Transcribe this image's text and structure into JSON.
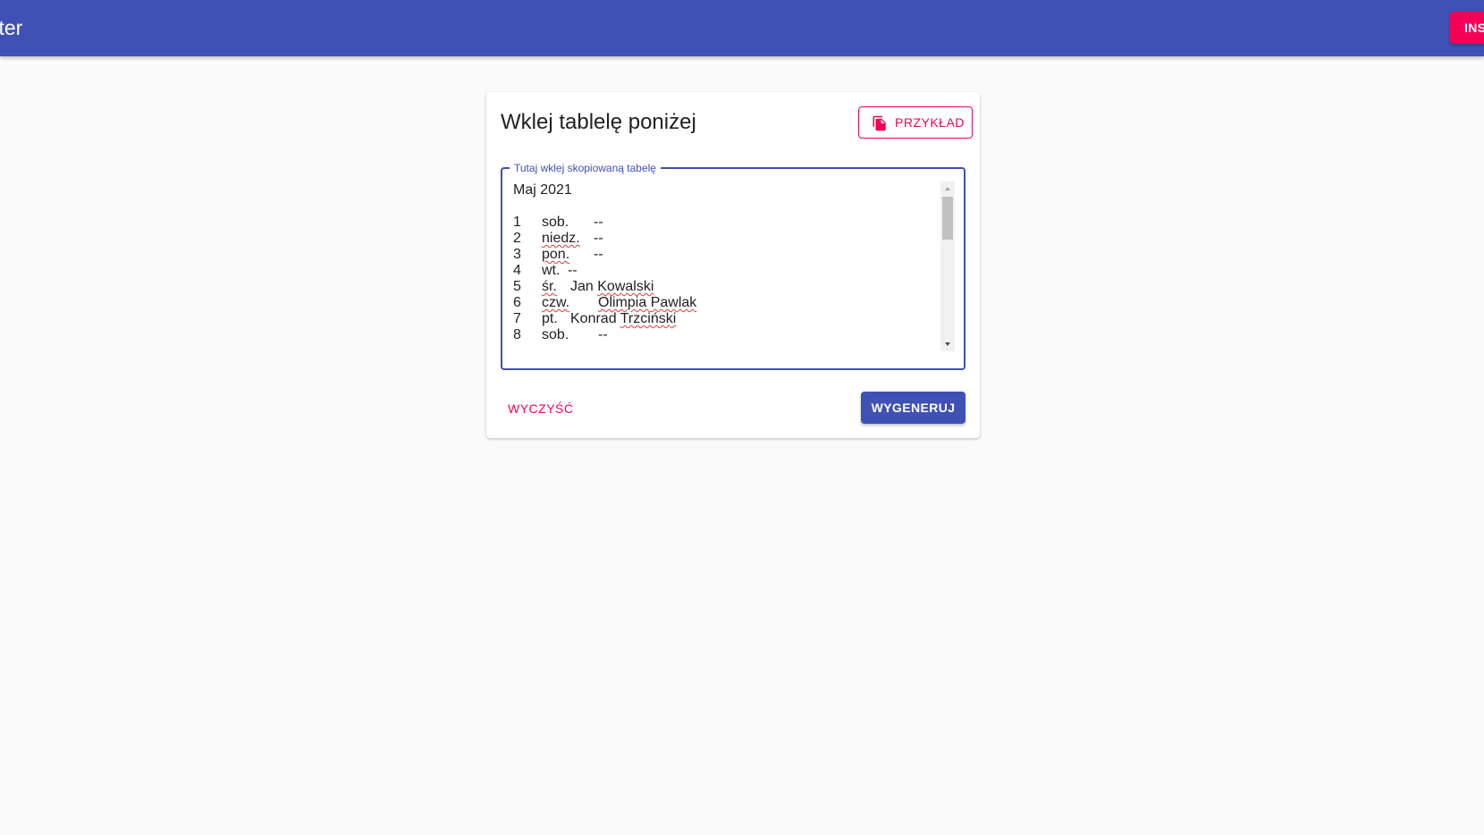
{
  "appbar": {
    "title": "orter",
    "install_label": "INS"
  },
  "card": {
    "title": "Wklej tablelę poniżej",
    "example_button": {
      "label": "PRZYKŁAD",
      "icon": "copy-icon"
    },
    "textarea": {
      "label": "Tutaj wklej skopiowaną tabelę",
      "header": "Maj 2021",
      "rows": [
        {
          "num": "1",
          "day": "sob.",
          "person": "--"
        },
        {
          "num": "2",
          "day": "niedz.",
          "person": "--"
        },
        {
          "num": "3",
          "day": "pon.",
          "person": "--"
        },
        {
          "num": "4",
          "day": "wt.",
          "person": "--"
        },
        {
          "num": "5",
          "day": "śr.",
          "person": "Jan Kowalski"
        },
        {
          "num": "6",
          "day": "czw.",
          "person": "Olimpia Pawlak"
        },
        {
          "num": "7",
          "day": "pt.",
          "person": "Konrad Trzciński"
        },
        {
          "num": "8",
          "day": "sob.",
          "person": "--"
        }
      ]
    },
    "clear_button": "WYCZYŚĆ",
    "generate_button": "WYGENERUJ"
  },
  "colors": {
    "primary": "#3f51b5",
    "accent": "#f50057",
    "background": "#fafafa"
  }
}
